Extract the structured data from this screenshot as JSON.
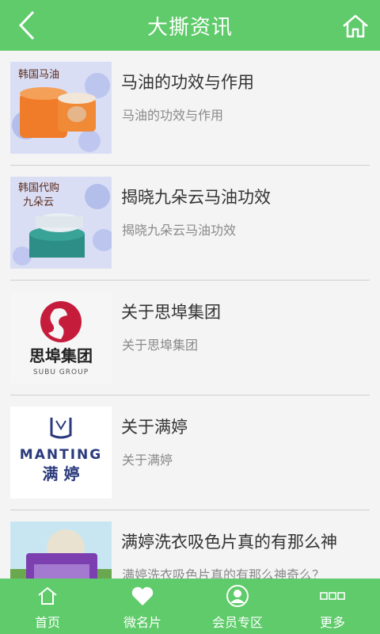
{
  "header": {
    "title": "大撕资讯",
    "back_icon": "chevron-left-icon",
    "home_icon": "home-icon"
  },
  "colors": {
    "brand_green": "#5fcb6a",
    "title_text": "#333333",
    "subtitle_text": "#8a8a8a",
    "divider": "#cfcfcf"
  },
  "articles": [
    {
      "title": "马油的功效与作用",
      "summary": "马油的功效与作用",
      "thumb_text": "韩国马油"
    },
    {
      "title": "揭晓九朵云马油功效",
      "summary": "揭晓九朵云马油功效",
      "thumb_text": "韩国代购\n九朵云"
    },
    {
      "title": "关于思埠集团",
      "summary": "关于思埠集团",
      "thumb_text": "思埠集团",
      "thumb_sub": "SUBU GROUP"
    },
    {
      "title": "关于满婷",
      "summary": "关于满婷",
      "thumb_text": "满 婷",
      "thumb_sub": "MANTING"
    },
    {
      "title": "满婷洗衣吸色片真的有那么神",
      "summary": "满婷洗衣吸色片真的有那么神奇么？"
    }
  ],
  "tabbar": [
    {
      "label": "首页",
      "icon": "home-icon"
    },
    {
      "label": "微名片",
      "icon": "heart-icon"
    },
    {
      "label": "会员专区",
      "icon": "user-icon"
    },
    {
      "label": "更多",
      "icon": "more-icon"
    }
  ]
}
